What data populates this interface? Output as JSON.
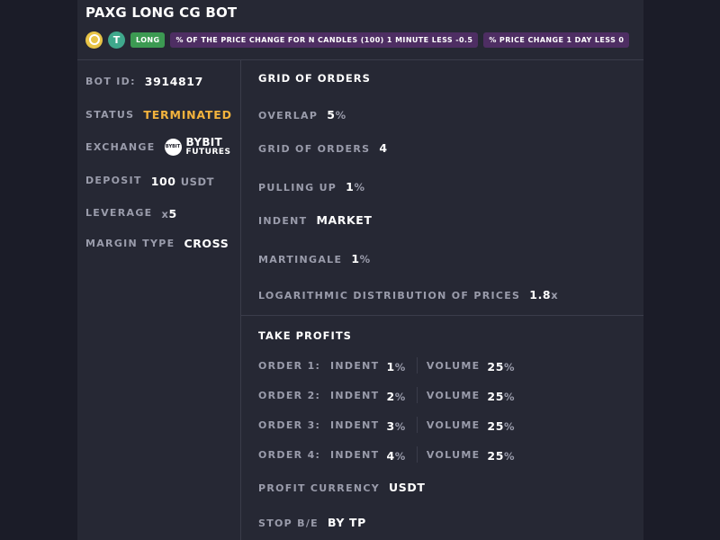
{
  "bot": {
    "title": "PAXG LONG CG BOT",
    "tags": {
      "coin_icons": [
        "paxg-gold-coin-icon",
        "tether-icon"
      ],
      "tether_glyph": "T",
      "direction": "LONG",
      "condition1": "% OF THE PRICE CHANGE FOR N CANDLES (100) 1 MINUTE LESS -0.5",
      "condition2": "% PRICE CHANGE 1 DAY LESS 0"
    }
  },
  "info": {
    "bot_id_label": "BOT ID:",
    "bot_id_value": "3914817",
    "status_label": "STATUS",
    "status_value": "TERMINATED",
    "exchange_label": "EXCHANGE",
    "exchange_logo_text": "BYBIT",
    "exchange_name": "BYBIT",
    "exchange_sub": "FUTURES",
    "deposit_label": "DEPOSIT",
    "deposit_value": "100",
    "deposit_unit": "USDT",
    "leverage_label": "LEVERAGE",
    "leverage_prefix": "x",
    "leverage_value": "5",
    "margin_label": "MARGIN TYPE",
    "margin_value": "CROSS"
  },
  "grid": {
    "title": "GRID OF ORDERS",
    "overlap_label": "OVERLAP",
    "overlap_value": "5",
    "overlap_unit": "%",
    "grid_label": "GRID OF ORDERS",
    "grid_value": "4",
    "pulling_label": "PULLING UP",
    "pulling_value": "1",
    "pulling_unit": "%",
    "indent_label": "INDENT",
    "indent_value": "MARKET",
    "martingale_label": "MARTINGALE",
    "martingale_value": "1",
    "martingale_unit": "%",
    "log_label": "LOGARITHMIC DISTRIBUTION OF PRICES",
    "log_value": "1.8",
    "log_unit": "x"
  },
  "take_profits": {
    "title": "TAKE PROFITS",
    "indent_label": "INDENT",
    "volume_label": "VOLUME",
    "orders": [
      {
        "label": "ORDER 1:",
        "indent": "1",
        "indent_unit": "%",
        "volume": "25",
        "volume_unit": "%"
      },
      {
        "label": "ORDER 2:",
        "indent": "2",
        "indent_unit": "%",
        "volume": "25",
        "volume_unit": "%"
      },
      {
        "label": "ORDER 3:",
        "indent": "3",
        "indent_unit": "%",
        "volume": "25",
        "volume_unit": "%"
      },
      {
        "label": "ORDER 4:",
        "indent": "4",
        "indent_unit": "%",
        "volume": "25",
        "volume_unit": "%"
      }
    ],
    "currency_label": "PROFIT CURRENCY",
    "currency_value": "USDT",
    "stop_label": "STOP B/E",
    "stop_value": "BY TP"
  },
  "colors": {
    "background": "#1b1c28",
    "card": "#262834",
    "status_terminated": "#f3b33d",
    "long_badge": "#3c9a52",
    "condition_badge": "#4e2e63",
    "label_gray": "#9a9cab"
  }
}
